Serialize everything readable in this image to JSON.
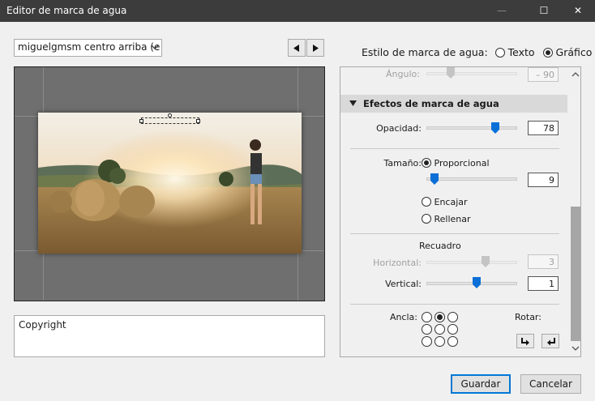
{
  "window": {
    "title": "Editor de marca de agua",
    "minimize": "—",
    "maximize": "☐",
    "close": "✕"
  },
  "preset": {
    "selected": "miguelgmsm centro arriba (e"
  },
  "copyright_text": "Copyright",
  "style": {
    "label": "Estilo de marca de agua:",
    "text_option": "Texto",
    "graphic_option": "Gráfico",
    "selected": "Gráfico"
  },
  "panel": {
    "angle": {
      "label": "Ángulo:",
      "value": "– 90"
    },
    "effects": {
      "header": "Efectos de marca de agua",
      "opacity": {
        "label": "Opacidad:",
        "value": "78",
        "fraction": 0.78
      },
      "size": {
        "label": "Tamaño:",
        "proportional": "Proporcional",
        "value": "9",
        "fit": "Encajar",
        "fill": "Rellenar",
        "fraction": 0.09
      },
      "inset": {
        "label": "Recuadro",
        "horizontal_label": "Horizontal:",
        "horizontal_value": "3",
        "vertical_label": "Vertical:",
        "vertical_value": "1"
      },
      "anchor": {
        "label": "Ancla:",
        "selected_index": 1
      },
      "rotate": {
        "label": "Rotar:"
      }
    }
  },
  "buttons": {
    "save": "Guardar",
    "cancel": "Cancelar"
  },
  "colors": {
    "accent": "#0078d7",
    "titlebar": "#3c3c3c",
    "preview_bg": "#6f6f6f"
  }
}
